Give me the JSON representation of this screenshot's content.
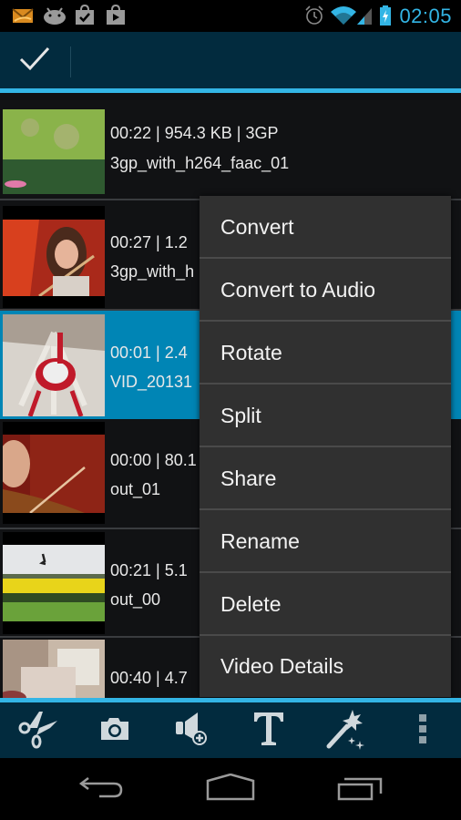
{
  "status_bar": {
    "left_icons": [
      "mail-icon",
      "android-icon",
      "store-check-icon",
      "play-store-icon"
    ],
    "right_icons": [
      "alarm-icon",
      "wifi-icon",
      "signal-icon",
      "battery-charging-icon"
    ],
    "time": "02:05",
    "accent_color": "#33b5e5"
  },
  "action_bar": {
    "done_icon": "checkmark-icon",
    "background_color": "#022b3e"
  },
  "videos": [
    {
      "meta": "00:22 | 954.3 KB | 3GP",
      "name": "3gp_with_h264_faac_01",
      "thumbnail": "grass-and-pond",
      "selected": false
    },
    {
      "meta": "00:27 | 1.2",
      "name": "3gp_with_h",
      "thumbnail": "violinist-red",
      "selected": false
    },
    {
      "meta": "00:01 | 2.4",
      "name": "VID_20131",
      "thumbnail": "white-bouquet",
      "selected": true
    },
    {
      "meta": "00:00 | 80.1",
      "name": "out_01",
      "thumbnail": "violinist-closeup",
      "selected": false
    },
    {
      "meta": "00:21 | 5.1",
      "name": "out_00",
      "thumbnail": "rapeseed-field-bird",
      "selected": false
    },
    {
      "meta": "00:40 | 4.7",
      "name": "",
      "thumbnail": "white-room",
      "selected": false
    }
  ],
  "context_menu": {
    "items": [
      {
        "label": "Convert"
      },
      {
        "label": "Convert to Audio"
      },
      {
        "label": "Rotate"
      },
      {
        "label": "Split"
      },
      {
        "label": "Share"
      },
      {
        "label": "Rename"
      },
      {
        "label": "Delete"
      },
      {
        "label": "Video Details"
      }
    ]
  },
  "toolbar": {
    "tools": [
      "scissors-icon",
      "camera-icon",
      "add-audio-icon",
      "text-icon",
      "magic-wand-icon",
      "overflow-menu-icon"
    ]
  },
  "nav_bar": {
    "buttons": [
      "back-icon",
      "home-icon",
      "recents-icon"
    ]
  },
  "colors": {
    "selected_row": "#0085b5",
    "menu_background": "#303030",
    "list_background": "#111214"
  }
}
